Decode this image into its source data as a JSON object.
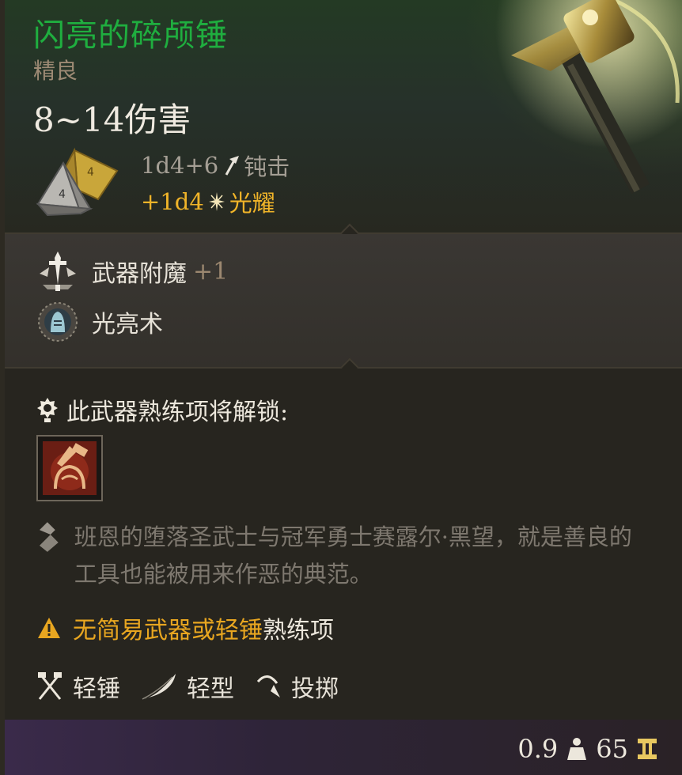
{
  "item": {
    "name": "闪亮的碎颅锤",
    "rarity": "精良",
    "damage_total": "8~14伤害",
    "damage_rows": [
      {
        "dice": "1d4+6",
        "type": "钝击",
        "icon": "mace-icon"
      },
      {
        "dice": "+1d4",
        "type": "光耀",
        "icon": "radiant-sparkle-icon"
      }
    ]
  },
  "enchantments": [
    {
      "label": "武器附魔",
      "bonus": "+1",
      "icon": "sword-enchant-icon"
    },
    {
      "label": "光亮术",
      "bonus": "",
      "icon": "light-spell-icon"
    }
  ],
  "proficiency": {
    "title": "此武器熟练项将解锁:",
    "passive_icon": "proficiency-passive-icon"
  },
  "lore": "班恩的堕落圣武士与冠军勇士赛露尔·黑望，就是善良的工具也能被用来作恶的典范。",
  "warning": {
    "highlight": "无简易武器或轻锤",
    "rest": "熟练项"
  },
  "properties": [
    {
      "label": "轻锤",
      "icon": "crossed-hammers-icon"
    },
    {
      "label": "轻型",
      "icon": "feather-icon"
    },
    {
      "label": "投掷",
      "icon": "throw-icon"
    }
  ],
  "footer": {
    "weight": "0.9",
    "value": "65"
  },
  "colors": {
    "name": "#1fae3f",
    "radiant": "#f0b429",
    "warning": "#e8a620"
  }
}
